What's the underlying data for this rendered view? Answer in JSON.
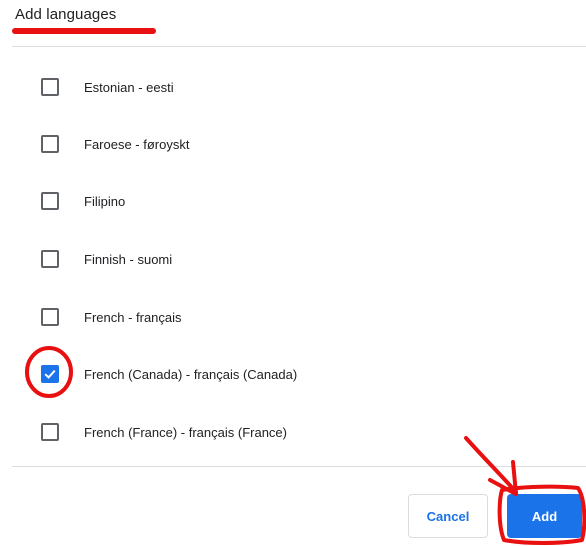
{
  "dialog": {
    "title": "Add languages"
  },
  "languages": [
    {
      "label": "Estonian - eesti",
      "checked": false
    },
    {
      "label": "Faroese - føroyskt",
      "checked": false
    },
    {
      "label": "Filipino",
      "checked": false
    },
    {
      "label": "Finnish - suomi",
      "checked": false
    },
    {
      "label": "French - français",
      "checked": false
    },
    {
      "label": "French (Canada) - français (Canada)",
      "checked": true
    },
    {
      "label": "French (France) - français (France)",
      "checked": false
    }
  ],
  "buttons": {
    "cancel_label": "Cancel",
    "add_label": "Add"
  },
  "colors": {
    "accent": "#1a73e8",
    "annotation": "#e81010"
  }
}
